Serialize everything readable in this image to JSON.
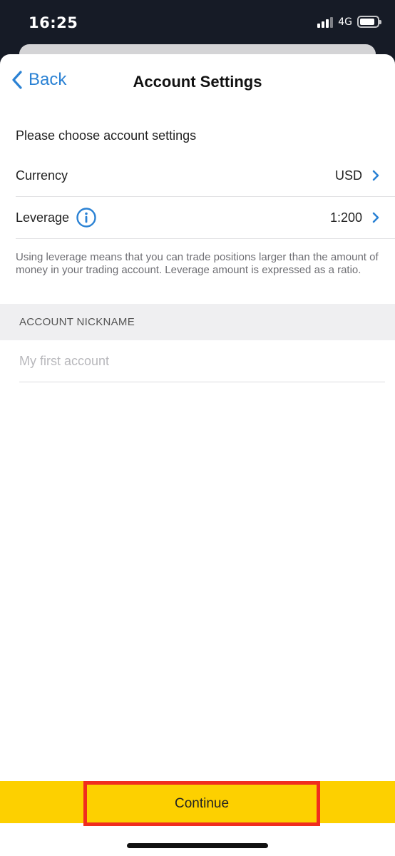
{
  "status_bar": {
    "time": "16:25",
    "network": "4G",
    "icons": [
      "signal-icon",
      "battery-icon"
    ]
  },
  "nav": {
    "back_label": "Back",
    "title": "Account Settings"
  },
  "intro_text": "Please choose account settings",
  "settings": [
    {
      "label": "Currency",
      "value": "USD",
      "icon": "chevron-right-icon"
    },
    {
      "label": "Leverage",
      "value": "1:200",
      "info_icon": "info-icon",
      "icon": "chevron-right-icon"
    }
  ],
  "leverage_note": "Using leverage means that you can trade positions larger than the amount of money in your trading account. Leverage amount is expressed as a ratio.",
  "nickname": {
    "header": "ACCOUNT NICKNAME",
    "placeholder": "My first account",
    "value": ""
  },
  "continue_label": "Continue",
  "colors": {
    "accent_blue": "#2b82d4",
    "button_yellow": "#fdd000",
    "highlight_red": "#f02d1e",
    "status_bar_bg": "#161b26"
  }
}
